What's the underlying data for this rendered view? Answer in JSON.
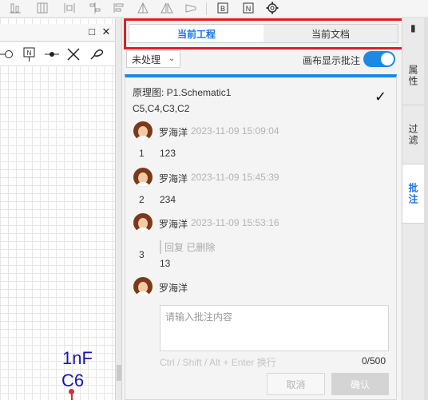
{
  "toolbar": {
    "icons": [
      "align-bottom-icon",
      "table-icon",
      "distribute-icon",
      "tree-icon",
      "align-left-icon",
      "triangle-icon",
      "flip-icon",
      "polygon-icon",
      "block-b-icon",
      "block-n-icon",
      "gear-icon"
    ],
    "block_b": "B",
    "block_n": "N"
  },
  "canvas": {
    "panel_buttons": [
      "□",
      "✕"
    ],
    "symbols": [
      "circle-terminal-icon",
      "net-port-icon",
      "junction-icon",
      "no-connect-icon",
      "probe-icon"
    ],
    "net_port_label": "N",
    "part_value": "1nF",
    "part_ref": "C6"
  },
  "tabs": {
    "current_project": "当前工程",
    "current_document": "当前文档"
  },
  "filter": {
    "selected": "未处理",
    "caret": "⌄"
  },
  "toggle": {
    "label": "画布显示批注",
    "on": true
  },
  "comment": {
    "schematic": "原理图: P1.Schematic1",
    "parts": "C5,C4,C3,C2",
    "check": "✓",
    "entries": [
      {
        "author": "罗海洋",
        "time": "2023-11-09 15:09:04",
        "index": "1",
        "text": "123"
      },
      {
        "author": "罗海洋",
        "time": "2023-11-09 15:45:39",
        "index": "2",
        "text": "234"
      },
      {
        "author": "罗海洋",
        "time": "2023-11-09 15:53:16",
        "index": "3",
        "reply": "回复 已删除",
        "text": "13"
      }
    ],
    "composer_author": "罗海洋",
    "placeholder": "请输入批注内容",
    "hint": "Ctrl / Shift / Alt + Enter 换行",
    "count": "0/500",
    "cancel": "取消",
    "confirm": "确认"
  },
  "side_tabs": {
    "pin": "▮",
    "properties": "属性",
    "filter": "过滤",
    "comments": "批注"
  },
  "colors": {
    "accent": "#1e88e5",
    "highlight": "#e01e24",
    "part_text": "#1515b5"
  }
}
